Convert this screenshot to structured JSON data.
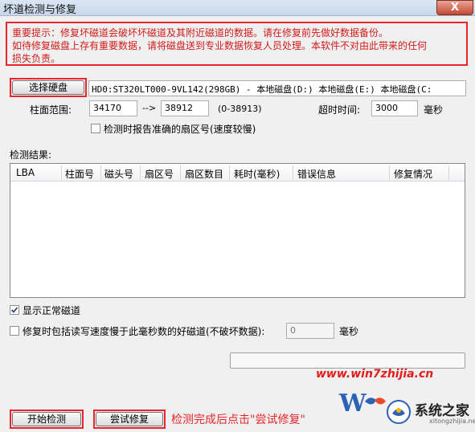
{
  "window": {
    "title": "坏道检测与修复",
    "close_label": "X"
  },
  "warning": {
    "lines": [
      "重要提示：修复坏磁道会破坏坏磁道及其附近磁道的数据。请在修复前先做好数据备份。",
      "如待修复磁盘上存有重要数据，请将磁盘送到专业数据恢复人员处理。本软件不对由此带来的任何",
      "损失负责。"
    ]
  },
  "disk": {
    "select_label": "选择硬盘",
    "info": "HD0:ST320LT000-9VL142(298GB) - 本地磁盘(D:) 本地磁盘(E:) 本地磁盘(C:"
  },
  "range": {
    "label": "柱面范围:",
    "start": "34170",
    "arrow": "-->",
    "end": "38912",
    "hint": "(0-38913)",
    "timeout_label": "超时时间:",
    "timeout": "3000",
    "timeout_unit": "毫秒"
  },
  "options": {
    "report_sector": "检测时报告准确的扇区号(速度较慢)",
    "show_normal": "显示正常磁道",
    "repair_slow": "修复时包括读写速度慢于此毫秒数的好磁道(不破坏数据):",
    "slow_value": "0",
    "slow_unit": "毫秒"
  },
  "results": {
    "label": "检测结果:",
    "columns": [
      "LBA",
      "柱面号",
      "磁头号",
      "扇区号",
      "扇区数目",
      "耗时(毫秒)",
      "错误信息",
      "修复情况"
    ]
  },
  "buttons": {
    "start": "开始检测",
    "try_repair": "尝试修复"
  },
  "annotation": "检测完成后点击\"尝试修复\"",
  "watermark": "www.win7zhijia.cn",
  "brand": {
    "name": "系统之家",
    "url": "xitongzhijia.net"
  },
  "colors": {
    "highlight": "#e8262a",
    "warning_text": "#d21a1a"
  }
}
